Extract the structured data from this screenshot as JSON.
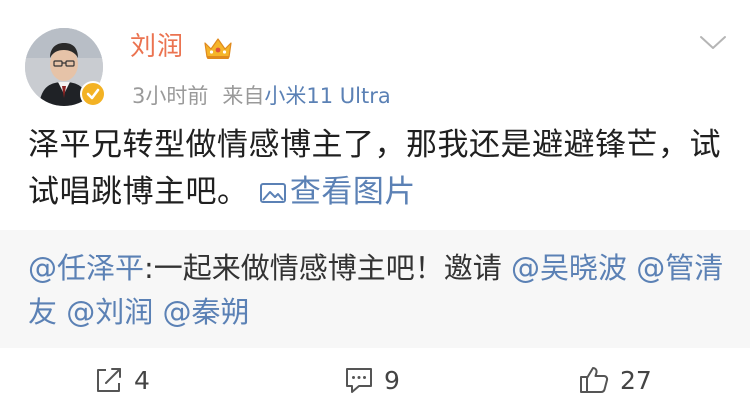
{
  "post": {
    "author": {
      "name": "刘润",
      "avatar": "avatar-photo",
      "verified_badge_color": "#f3b224",
      "vip_icon": "crown-icon"
    },
    "meta": {
      "time": "3小时前",
      "source_prefix": "来自",
      "source": "小米11 Ultra"
    },
    "text": "泽平兄转型做情感博主了，那我还是避避锋芒，试试唱跳博主吧。",
    "view_pictures_label": "查看图片",
    "repost": {
      "author_mention": "@任泽平",
      "separator": ":",
      "text": "一起来做情感博主吧！邀请 ",
      "mentions": [
        "@吴晓波",
        "@管清友",
        "@刘润",
        "@秦朔"
      ]
    },
    "actions": {
      "repost_count": "4",
      "comment_count": "9",
      "like_count": "27"
    }
  },
  "colors": {
    "username": "#eb7350",
    "link": "#5b81b5",
    "meta": "#9a9a9a",
    "repost_bg": "#f7f7f7"
  }
}
